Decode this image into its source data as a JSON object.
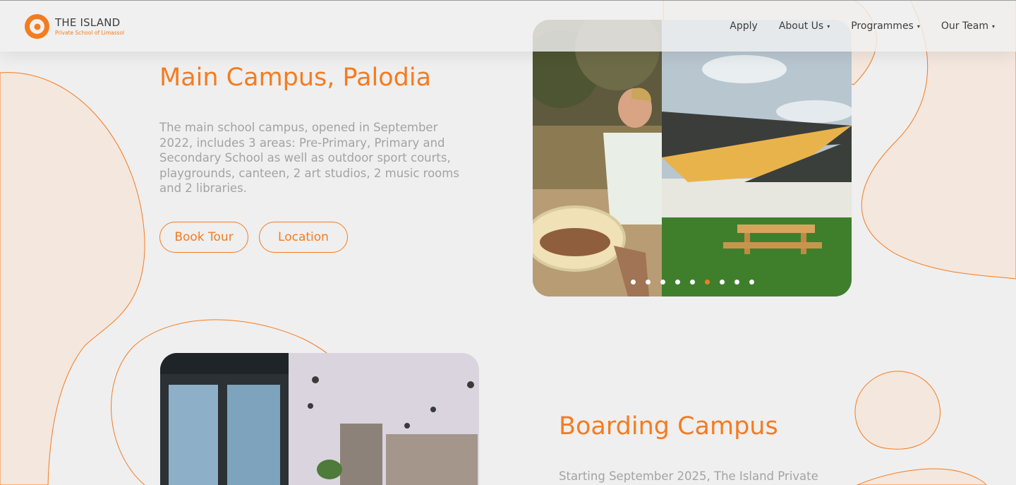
{
  "brand": {
    "name": "THE ISLAND",
    "tagline": "Private School of Limassol",
    "accent_color": "#f47c20"
  },
  "nav": {
    "items": [
      {
        "label": "Apply",
        "has_dropdown": false
      },
      {
        "label": "About Us",
        "has_dropdown": true
      },
      {
        "label": "Programmes",
        "has_dropdown": true
      },
      {
        "label": "Our Team",
        "has_dropdown": true
      }
    ],
    "caret": "▾"
  },
  "main_campus": {
    "title": "Main Campus, Palodia",
    "description": "The main school campus, opened in September 2022, includes 3 areas: Pre-Primary, Primary and Secondary School as well as outdoor sport courts, playgrounds, canteen, 2 art studios, 2 music rooms and 2 libraries.",
    "book_tour_label": "Book Tour",
    "location_label": "Location",
    "gallery": {
      "slide_count": 9,
      "active_slide": 6,
      "images": [
        "child carrying a sieve outdoors",
        "outdoor picnic area with shade sails"
      ]
    }
  },
  "boarding_campus": {
    "title": "Boarding Campus",
    "description_preview": "Starting September 2025, The Island Private",
    "images": [
      "gym",
      "modern kitchen interior"
    ]
  }
}
